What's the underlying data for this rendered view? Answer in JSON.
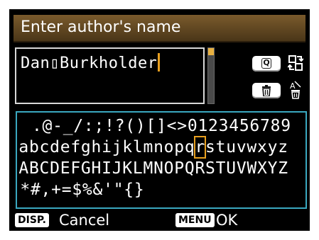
{
  "title": "Enter author's name",
  "name_field": {
    "value": "Dan▯Burkholder"
  },
  "buttons": {
    "q_key_label": "Q",
    "switch_icon": "switch-palette-icon",
    "trash_icon": "trash-icon",
    "delete_char_icon": "delete-character-icon"
  },
  "character_palette": {
    "rows": [
      " .@-_/:;!?()[]<>0123456789",
      "abcdefghijklmnopqrstuvwxyz",
      "ABCDEFGHIJKLMNOPQRSTUVWXYZ",
      "*#,+=$%&'\"{}"
    ],
    "selected_row": 1,
    "selected_col": 17
  },
  "footer": {
    "disp_button": "DISP.",
    "cancel_label": "Cancel",
    "menu_button": "MENU",
    "ok_label": "OK"
  },
  "colors": {
    "title_bar": "#6a4e24",
    "cursor": "#e8a020",
    "palette_border": "#3aa8c0",
    "background": "#000000"
  }
}
